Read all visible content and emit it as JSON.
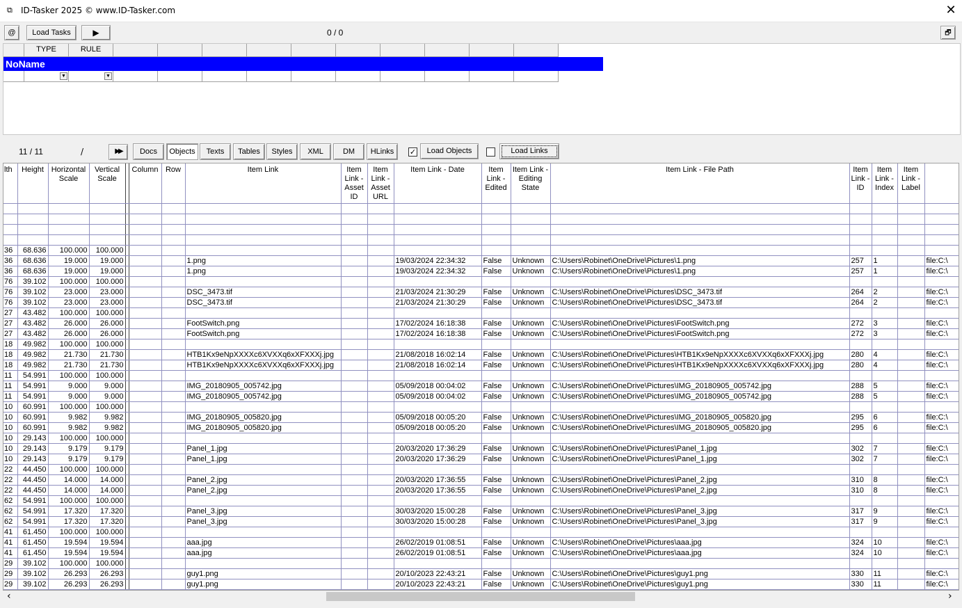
{
  "window": {
    "title": "ID-Tasker 2025  © www.ID-Tasker.com",
    "icon": "app-icon",
    "close_label": "✕"
  },
  "toolbar": {
    "at_label": "@",
    "load_tasks_label": "Load Tasks",
    "play_label": "▶",
    "task_counter": "0 / 0",
    "restore_label": "🗗"
  },
  "rule_grid": {
    "headers": [
      "",
      "TYPE",
      "RULE",
      "",
      "",
      "",
      "",
      "",
      "",
      "",
      "",
      "",
      "",
      ""
    ],
    "row_name": "NoName"
  },
  "objects_bar": {
    "counter": "11 / 11",
    "slash": "/",
    "forward_label": "▶▶",
    "tabs": [
      "Docs",
      "Objects",
      "Texts",
      "Tables",
      "Styles",
      "XML",
      "DM",
      "HLinks"
    ],
    "load_objects_label": "Load Objects",
    "load_objects_checked": true,
    "load_links_label": "Load Links",
    "load_links_checked": false
  },
  "grid": {
    "columns": [
      "lth",
      "Height",
      "Horizontal Scale",
      "Vertical Scale",
      "",
      "Column",
      "Row",
      "Item Link",
      "Item Link - Asset ID",
      "Item Link - Asset URL",
      "Item Link - Date",
      "Item Link - Edited",
      "Item Link - Editing State",
      "Item Link - File Path",
      "Item Link - ID",
      "Item Link - Index",
      "Item Link - Label",
      ""
    ],
    "rows": [
      [
        "",
        "",
        "",
        "",
        "",
        "",
        "",
        "",
        "",
        "",
        "",
        "",
        "",
        "",
        "",
        "",
        "",
        ""
      ],
      [
        "",
        "",
        "",
        "",
        "",
        "",
        "",
        "",
        "",
        "",
        "",
        "",
        "",
        "",
        "",
        "",
        "",
        ""
      ],
      [
        "",
        "",
        "",
        "",
        "",
        "",
        "",
        "",
        "",
        "",
        "",
        "",
        "",
        "",
        "",
        "",
        "",
        ""
      ],
      [
        "",
        "",
        "",
        "",
        "",
        "",
        "",
        "",
        "",
        "",
        "",
        "",
        "",
        "",
        "",
        "",
        "",
        ""
      ],
      [
        "36",
        "68.636",
        "100.000",
        "100.000",
        "",
        "",
        "",
        "",
        "",
        "",
        "",
        "",
        "",
        "",
        "",
        "",
        "",
        ""
      ],
      [
        "36",
        "68.636",
        "19.000",
        "19.000",
        "",
        "",
        "",
        "1.png",
        "",
        "",
        "19/03/2024 22:34:32",
        "False",
        "Unknown",
        "C:\\Users\\Robinet\\OneDrive\\Pictures\\1.png",
        "257",
        "1",
        "",
        "file:C:\\"
      ],
      [
        "36",
        "68.636",
        "19.000",
        "19.000",
        "",
        "",
        "",
        "1.png",
        "",
        "",
        "19/03/2024 22:34:32",
        "False",
        "Unknown",
        "C:\\Users\\Robinet\\OneDrive\\Pictures\\1.png",
        "257",
        "1",
        "",
        "file:C:\\"
      ],
      [
        "76",
        "39.102",
        "100.000",
        "100.000",
        "",
        "",
        "",
        "",
        "",
        "",
        "",
        "",
        "",
        "",
        "",
        "",
        "",
        ""
      ],
      [
        "76",
        "39.102",
        "23.000",
        "23.000",
        "",
        "",
        "",
        "DSC_3473.tif",
        "",
        "",
        "21/03/2024 21:30:29",
        "False",
        "Unknown",
        "C:\\Users\\Robinet\\OneDrive\\Pictures\\DSC_3473.tif",
        "264",
        "2",
        "",
        "file:C:\\"
      ],
      [
        "76",
        "39.102",
        "23.000",
        "23.000",
        "",
        "",
        "",
        "DSC_3473.tif",
        "",
        "",
        "21/03/2024 21:30:29",
        "False",
        "Unknown",
        "C:\\Users\\Robinet\\OneDrive\\Pictures\\DSC_3473.tif",
        "264",
        "2",
        "",
        "file:C:\\"
      ],
      [
        "27",
        "43.482",
        "100.000",
        "100.000",
        "",
        "",
        "",
        "",
        "",
        "",
        "",
        "",
        "",
        "",
        "",
        "",
        "",
        ""
      ],
      [
        "27",
        "43.482",
        "26.000",
        "26.000",
        "",
        "",
        "",
        "FootSwitch.png",
        "",
        "",
        "17/02/2024 16:18:38",
        "False",
        "Unknown",
        "C:\\Users\\Robinet\\OneDrive\\Pictures\\FootSwitch.png",
        "272",
        "3",
        "",
        "file:C:\\"
      ],
      [
        "27",
        "43.482",
        "26.000",
        "26.000",
        "",
        "",
        "",
        "FootSwitch.png",
        "",
        "",
        "17/02/2024 16:18:38",
        "False",
        "Unknown",
        "C:\\Users\\Robinet\\OneDrive\\Pictures\\FootSwitch.png",
        "272",
        "3",
        "",
        "file:C:\\"
      ],
      [
        "18",
        "49.982",
        "100.000",
        "100.000",
        "",
        "",
        "",
        "",
        "",
        "",
        "",
        "",
        "",
        "",
        "",
        "",
        "",
        ""
      ],
      [
        "18",
        "49.982",
        "21.730",
        "21.730",
        "",
        "",
        "",
        "HTB1Kx9eNpXXXXc6XVXXq6xXFXXXj.jpg",
        "",
        "",
        "21/08/2018 16:02:14",
        "False",
        "Unknown",
        "C:\\Users\\Robinet\\OneDrive\\Pictures\\HTB1Kx9eNpXXXXc6XVXXq6xXFXXXj.jpg",
        "280",
        "4",
        "",
        "file:C:\\"
      ],
      [
        "18",
        "49.982",
        "21.730",
        "21.730",
        "",
        "",
        "",
        "HTB1Kx9eNpXXXXc6XVXXq6xXFXXXj.jpg",
        "",
        "",
        "21/08/2018 16:02:14",
        "False",
        "Unknown",
        "C:\\Users\\Robinet\\OneDrive\\Pictures\\HTB1Kx9eNpXXXXc6XVXXq6xXFXXXj.jpg",
        "280",
        "4",
        "",
        "file:C:\\"
      ],
      [
        "11",
        "54.991",
        "100.000",
        "100.000",
        "",
        "",
        "",
        "",
        "",
        "",
        "",
        "",
        "",
        "",
        "",
        "",
        "",
        ""
      ],
      [
        "11",
        "54.991",
        "9.000",
        "9.000",
        "",
        "",
        "",
        "IMG_20180905_005742.jpg",
        "",
        "",
        "05/09/2018 00:04:02",
        "False",
        "Unknown",
        "C:\\Users\\Robinet\\OneDrive\\Pictures\\IMG_20180905_005742.jpg",
        "288",
        "5",
        "",
        "file:C:\\"
      ],
      [
        "11",
        "54.991",
        "9.000",
        "9.000",
        "",
        "",
        "",
        "IMG_20180905_005742.jpg",
        "",
        "",
        "05/09/2018 00:04:02",
        "False",
        "Unknown",
        "C:\\Users\\Robinet\\OneDrive\\Pictures\\IMG_20180905_005742.jpg",
        "288",
        "5",
        "",
        "file:C:\\"
      ],
      [
        "10",
        "60.991",
        "100.000",
        "100.000",
        "",
        "",
        "",
        "",
        "",
        "",
        "",
        "",
        "",
        "",
        "",
        "",
        "",
        ""
      ],
      [
        "10",
        "60.991",
        "9.982",
        "9.982",
        "",
        "",
        "",
        "IMG_20180905_005820.jpg",
        "",
        "",
        "05/09/2018 00:05:20",
        "False",
        "Unknown",
        "C:\\Users\\Robinet\\OneDrive\\Pictures\\IMG_20180905_005820.jpg",
        "295",
        "6",
        "",
        "file:C:\\"
      ],
      [
        "10",
        "60.991",
        "9.982",
        "9.982",
        "",
        "",
        "",
        "IMG_20180905_005820.jpg",
        "",
        "",
        "05/09/2018 00:05:20",
        "False",
        "Unknown",
        "C:\\Users\\Robinet\\OneDrive\\Pictures\\IMG_20180905_005820.jpg",
        "295",
        "6",
        "",
        "file:C:\\"
      ],
      [
        "10",
        "29.143",
        "100.000",
        "100.000",
        "",
        "",
        "",
        "",
        "",
        "",
        "",
        "",
        "",
        "",
        "",
        "",
        "",
        ""
      ],
      [
        "10",
        "29.143",
        "9.179",
        "9.179",
        "",
        "",
        "",
        "Panel_1.jpg",
        "",
        "",
        "20/03/2020 17:36:29",
        "False",
        "Unknown",
        "C:\\Users\\Robinet\\OneDrive\\Pictures\\Panel_1.jpg",
        "302",
        "7",
        "",
        "file:C:\\"
      ],
      [
        "10",
        "29.143",
        "9.179",
        "9.179",
        "",
        "",
        "",
        "Panel_1.jpg",
        "",
        "",
        "20/03/2020 17:36:29",
        "False",
        "Unknown",
        "C:\\Users\\Robinet\\OneDrive\\Pictures\\Panel_1.jpg",
        "302",
        "7",
        "",
        "file:C:\\"
      ],
      [
        "22",
        "44.450",
        "100.000",
        "100.000",
        "",
        "",
        "",
        "",
        "",
        "",
        "",
        "",
        "",
        "",
        "",
        "",
        "",
        ""
      ],
      [
        "22",
        "44.450",
        "14.000",
        "14.000",
        "",
        "",
        "",
        "Panel_2.jpg",
        "",
        "",
        "20/03/2020 17:36:55",
        "False",
        "Unknown",
        "C:\\Users\\Robinet\\OneDrive\\Pictures\\Panel_2.jpg",
        "310",
        "8",
        "",
        "file:C:\\"
      ],
      [
        "22",
        "44.450",
        "14.000",
        "14.000",
        "",
        "",
        "",
        "Panel_2.jpg",
        "",
        "",
        "20/03/2020 17:36:55",
        "False",
        "Unknown",
        "C:\\Users\\Robinet\\OneDrive\\Pictures\\Panel_2.jpg",
        "310",
        "8",
        "",
        "file:C:\\"
      ],
      [
        "62",
        "54.991",
        "100.000",
        "100.000",
        "",
        "",
        "",
        "",
        "",
        "",
        "",
        "",
        "",
        "",
        "",
        "",
        "",
        ""
      ],
      [
        "62",
        "54.991",
        "17.320",
        "17.320",
        "",
        "",
        "",
        "Panel_3.jpg",
        "",
        "",
        "30/03/2020 15:00:28",
        "False",
        "Unknown",
        "C:\\Users\\Robinet\\OneDrive\\Pictures\\Panel_3.jpg",
        "317",
        "9",
        "",
        "file:C:\\"
      ],
      [
        "62",
        "54.991",
        "17.320",
        "17.320",
        "",
        "",
        "",
        "Panel_3.jpg",
        "",
        "",
        "30/03/2020 15:00:28",
        "False",
        "Unknown",
        "C:\\Users\\Robinet\\OneDrive\\Pictures\\Panel_3.jpg",
        "317",
        "9",
        "",
        "file:C:\\"
      ],
      [
        "41",
        "61.450",
        "100.000",
        "100.000",
        "",
        "",
        "",
        "",
        "",
        "",
        "",
        "",
        "",
        "",
        "",
        "",
        "",
        ""
      ],
      [
        "41",
        "61.450",
        "19.594",
        "19.594",
        "",
        "",
        "",
        "aaa.jpg",
        "",
        "",
        "26/02/2019 01:08:51",
        "False",
        "Unknown",
        "C:\\Users\\Robinet\\OneDrive\\Pictures\\aaa.jpg",
        "324",
        "10",
        "",
        "file:C:\\"
      ],
      [
        "41",
        "61.450",
        "19.594",
        "19.594",
        "",
        "",
        "",
        "aaa.jpg",
        "",
        "",
        "26/02/2019 01:08:51",
        "False",
        "Unknown",
        "C:\\Users\\Robinet\\OneDrive\\Pictures\\aaa.jpg",
        "324",
        "10",
        "",
        "file:C:\\"
      ],
      [
        "29",
        "39.102",
        "100.000",
        "100.000",
        "",
        "",
        "",
        "",
        "",
        "",
        "",
        "",
        "",
        "",
        "",
        "",
        "",
        ""
      ],
      [
        "29",
        "39.102",
        "26.293",
        "26.293",
        "",
        "",
        "",
        "guy1.png",
        "",
        "",
        "20/10/2023 22:43:21",
        "False",
        "Unknown",
        "C:\\Users\\Robinet\\OneDrive\\Pictures\\guy1.png",
        "330",
        "11",
        "",
        "file:C:\\"
      ],
      [
        "29",
        "39.102",
        "26.293",
        "26.293",
        "",
        "",
        "",
        "guy1.png",
        "",
        "",
        "20/10/2023 22:43:21",
        "False",
        "Unknown",
        "C:\\Users\\Robinet\\OneDrive\\Pictures\\guy1.png",
        "330",
        "11",
        "",
        "file:C:\\"
      ]
    ]
  },
  "scrollbar": {
    "left_arrow": "‹",
    "right_arrow": "›"
  }
}
